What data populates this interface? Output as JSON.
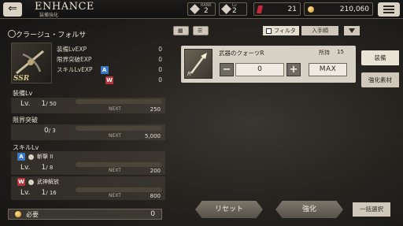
{
  "header": {
    "title": "ENHANCE",
    "subtitle": "装備強化",
    "rank_label": "RANK",
    "rank_value": "2",
    "level_label": "Lv",
    "level_value": "2",
    "crystal_count": "21",
    "gold_count": "210,060",
    "icons": [
      "back-arrow-icon",
      "diamond-icon",
      "red-crystal-icon",
      "gold-orb-icon",
      "menu-icon"
    ]
  },
  "character": {
    "name": "クラージュ・フォルサ",
    "rarity": "SSR"
  },
  "exp": {
    "rows": [
      {
        "label": "装備LvEXP",
        "value": "0"
      },
      {
        "label": "限界突破EXP",
        "value": "0"
      },
      {
        "label": "スキルLvEXP",
        "badge": "A",
        "value": "0"
      },
      {
        "label": "",
        "badge": "W",
        "value": "0"
      }
    ]
  },
  "equip_lv": {
    "section": "装備Lv",
    "lv_label": "Lv.",
    "current": "1",
    "max": "/ 50",
    "next_label": "NEXT",
    "next_value": "250"
  },
  "limit_break": {
    "section": "限界突破",
    "current": "0",
    "max": "/ 3",
    "next_label": "NEXT",
    "next_value": "5,000"
  },
  "skill_lv": {
    "section": "スキルLv",
    "skills": [
      {
        "badge": "A",
        "name": "斬撃 II",
        "lv_label": "Lv.",
        "current": "1",
        "max": "/ 8",
        "next_label": "NEXT",
        "next_value": "200"
      },
      {
        "badge": "W",
        "name": "武神解放",
        "lv_label": "Lv.",
        "current": "1",
        "max": "/ 16",
        "next_label": "NEXT",
        "next_value": "800"
      }
    ]
  },
  "need": {
    "label": "必要",
    "value": "0"
  },
  "toolbar": {
    "filter_label": "フィルタ",
    "sort_label": "入手順"
  },
  "material": {
    "name": "武器のクォーツR",
    "owned_label": "所持",
    "owned_value": "15",
    "rarity": "R",
    "quantity": "0",
    "minus": "−",
    "plus": "+",
    "max_label": "MAX"
  },
  "side_tabs": [
    {
      "label": "装備",
      "active": true
    },
    {
      "label": "強化素材",
      "active": false
    }
  ],
  "actions": {
    "reset": "リセット",
    "enhance": "強化",
    "bulk_select": "一括選択"
  },
  "colors": {
    "badge_a": "#3b78c8",
    "badge_w": "#b6343b",
    "crystal": "#c4283a",
    "gold": "#c7922a"
  }
}
